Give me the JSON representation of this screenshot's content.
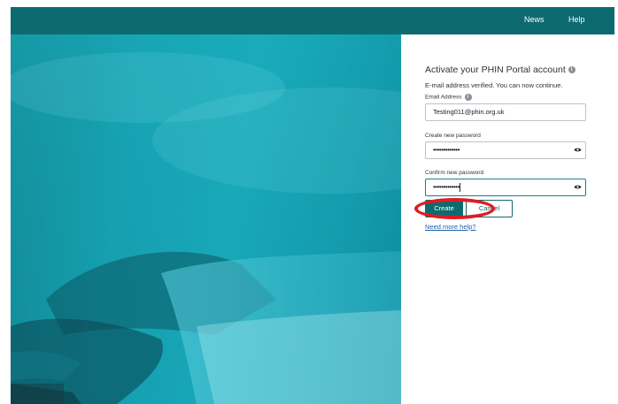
{
  "topnav": {
    "links": [
      "News",
      "Help"
    ],
    "bg_color": "#0d6b6f"
  },
  "panel": {
    "title": "Activate your PHIN Portal account",
    "title_icon": "info-icon",
    "subtitle": "E-mail address verified. You can now continue.",
    "email": {
      "label": "Email Address",
      "label_icon": "info-icon",
      "value": "Testing011@phin.org.uk"
    },
    "new_password": {
      "label": "Create new password",
      "value": "•••••••••••••",
      "toggle_icon": "eye-icon"
    },
    "confirm_password": {
      "label": "Confirm new password",
      "value": "•••••••••••••",
      "toggle_icon": "eye-icon"
    },
    "create_label": "Create",
    "cancel_label": "Cancel",
    "help_link": "Need more help?"
  },
  "annotation": {
    "highlight": "create-button",
    "color": "#e01b22"
  }
}
